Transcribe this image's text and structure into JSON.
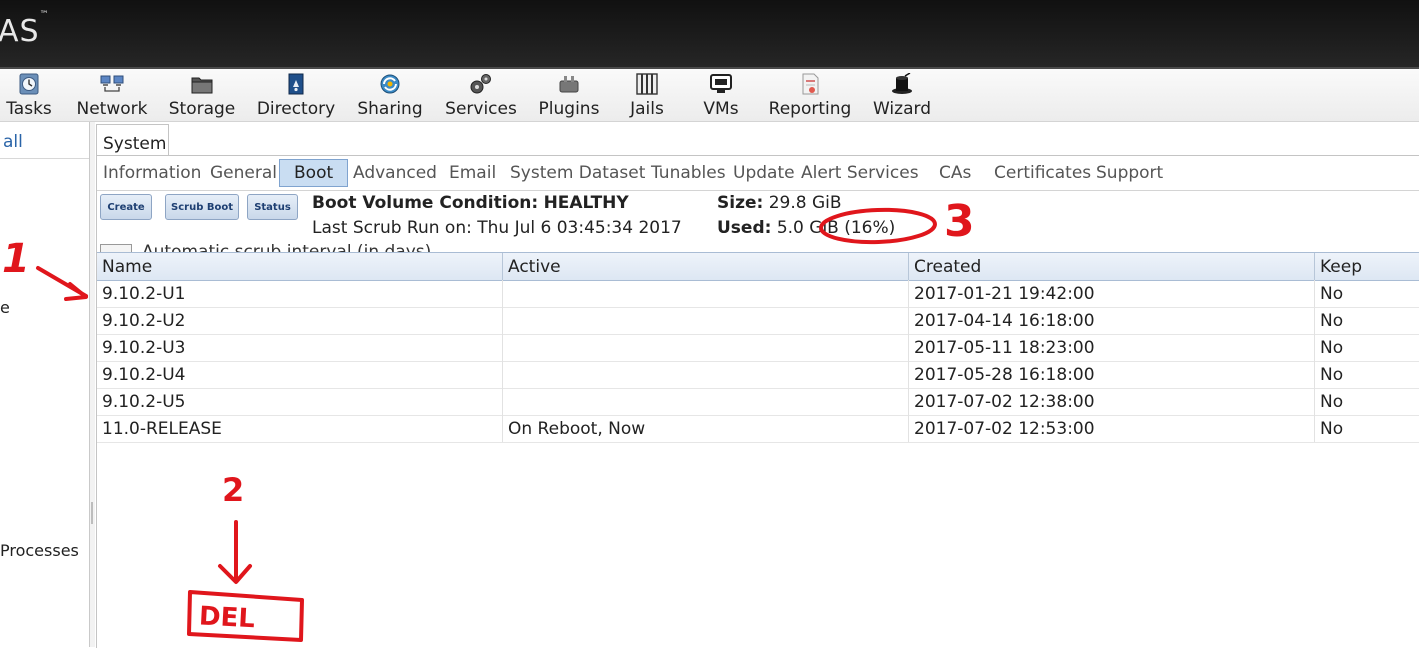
{
  "banner": {
    "logo": "AS",
    "logo_mark": "™"
  },
  "toolbar": {
    "items": [
      {
        "label": "Tasks",
        "icon": "clock-icon"
      },
      {
        "label": "Network",
        "icon": "network-icon"
      },
      {
        "label": "Storage",
        "icon": "folder-icon"
      },
      {
        "label": "Directory",
        "icon": "directory-icon"
      },
      {
        "label": "Sharing",
        "icon": "sharing-icon"
      },
      {
        "label": "Services",
        "icon": "gears-icon"
      },
      {
        "label": "Plugins",
        "icon": "plugin-icon"
      },
      {
        "label": "Jails",
        "icon": "jails-icon"
      },
      {
        "label": "VMs",
        "icon": "monitor-icon"
      },
      {
        "label": "Reporting",
        "icon": "report-icon"
      },
      {
        "label": "Wizard",
        "icon": "wizard-hat-icon"
      }
    ]
  },
  "leftpane": {
    "all": "all",
    "partial_item": "e",
    "processes": "Processes"
  },
  "system_tab": "System",
  "subtabs": [
    "Information",
    "General",
    "Boot",
    "Advanced",
    "Email",
    "System Dataset",
    "Tunables",
    "Update",
    "Alert Services",
    "CAs",
    "Certificates",
    "Support"
  ],
  "active_subtab": "Boot",
  "boot": {
    "buttons": {
      "create": "Create",
      "scrub": "Scrub Boot",
      "status": "Status"
    },
    "condition_label": "Boot Volume Condition:",
    "condition_value": "HEALTHY",
    "last_scrub_label": "Last Scrub Run on:",
    "last_scrub_value": "Thu Jul 6 03:45:34 2017",
    "size_label": "Size:",
    "size_value": "29.8 GiB",
    "used_label": "Used:",
    "used_value": "5.0 GiB (16%)",
    "scrub_interval_label": "Automatic scrub interval (in days)"
  },
  "grid": {
    "columns": [
      "Name",
      "Active",
      "Created",
      "Keep"
    ],
    "rows": [
      {
        "name": "9.10.2-U1",
        "active": "",
        "created": "2017-01-21 19:42:00",
        "keep": "No"
      },
      {
        "name": "9.10.2-U2",
        "active": "",
        "created": "2017-04-14 16:18:00",
        "keep": "No"
      },
      {
        "name": "9.10.2-U3",
        "active": "",
        "created": "2017-05-11 18:23:00",
        "keep": "No"
      },
      {
        "name": "9.10.2-U4",
        "active": "",
        "created": "2017-05-28 16:18:00",
        "keep": "No"
      },
      {
        "name": "9.10.2-U5",
        "active": "",
        "created": "2017-07-02 12:38:00",
        "keep": "No"
      },
      {
        "name": "11.0-RELEASE",
        "active": "On Reboot, Now",
        "created": "2017-07-02 12:53:00",
        "keep": "No"
      }
    ]
  },
  "annotations": {
    "color": "#e0161c",
    "label_1": "1",
    "label_2": "2",
    "label_3": "3",
    "del_box": "DEL"
  }
}
